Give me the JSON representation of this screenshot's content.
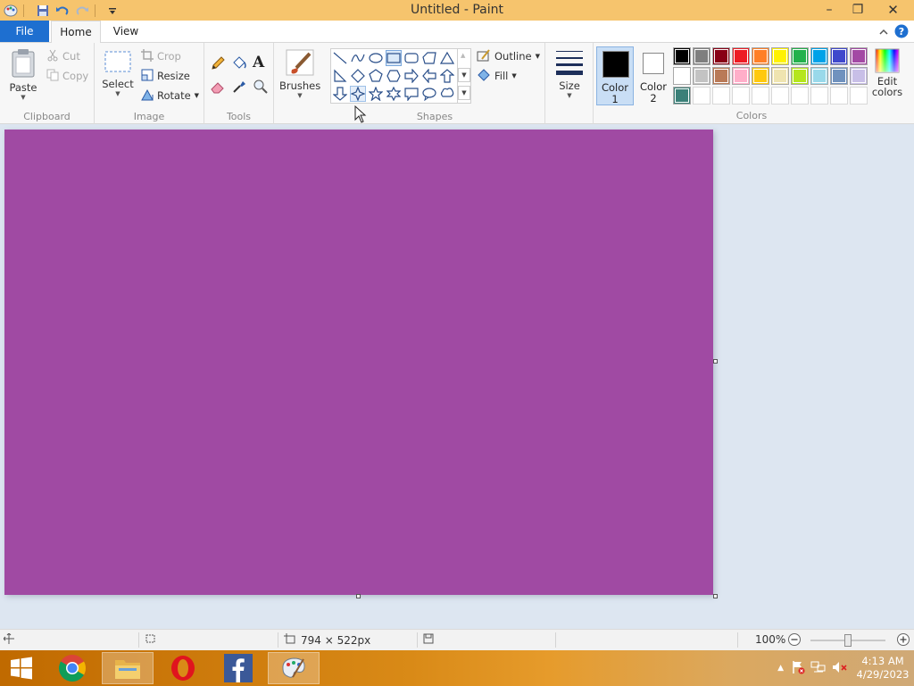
{
  "window": {
    "title": "Untitled - Paint",
    "controls": {
      "minimize": "–",
      "restore": "❐",
      "close": "✕"
    }
  },
  "menu_tabs": {
    "file": "File",
    "home": "Home",
    "view": "View"
  },
  "ribbon": {
    "clipboard": {
      "label": "Clipboard",
      "paste": "Paste",
      "cut": "Cut",
      "copy": "Copy"
    },
    "image": {
      "label": "Image",
      "select": "Select",
      "crop": "Crop",
      "resize": "Resize",
      "rotate": "Rotate"
    },
    "tools": {
      "label": "Tools",
      "text_glyph": "A"
    },
    "brushes": {
      "label": "Brushes"
    },
    "shapes": {
      "label": "Shapes",
      "outline": "Outline",
      "fill": "Fill"
    },
    "size": {
      "label": "Size"
    },
    "color1": {
      "label": "Color",
      "number": "1",
      "value": "#000000"
    },
    "color2": {
      "label": "Color",
      "number": "2",
      "value": "#ffffff"
    },
    "colors": {
      "label": "Colors",
      "edit_label_1": "Edit",
      "edit_label_2": "colors",
      "palette": [
        [
          "#000000",
          "#7f7f7f",
          "#880015",
          "#ed1c24",
          "#ff7f27",
          "#fff200",
          "#22b14c",
          "#00a2e8",
          "#3f48cc",
          "#a349a4"
        ],
        [
          "#ffffff",
          "#c3c3c3",
          "#b97a57",
          "#ffaec9",
          "#ffc90e",
          "#efe4b0",
          "#b5e61d",
          "#99d9ea",
          "#7092be",
          "#c8bfe7"
        ],
        [
          "#3a8078",
          "",
          "",
          "",
          "",
          "",
          "",
          "",
          "",
          ""
        ]
      ]
    }
  },
  "canvas": {
    "fill_color": "#a04aa3"
  },
  "statusbar": {
    "dimensions": "794 × 522px",
    "zoom": "100%",
    "zoom_fraction": 0.5
  },
  "taskbar": {
    "apps": [
      "windows-start",
      "chrome",
      "file-explorer",
      "opera",
      "facebook",
      "paint"
    ],
    "clock_time": "4:13 AM",
    "clock_date": "4/29/2023"
  }
}
